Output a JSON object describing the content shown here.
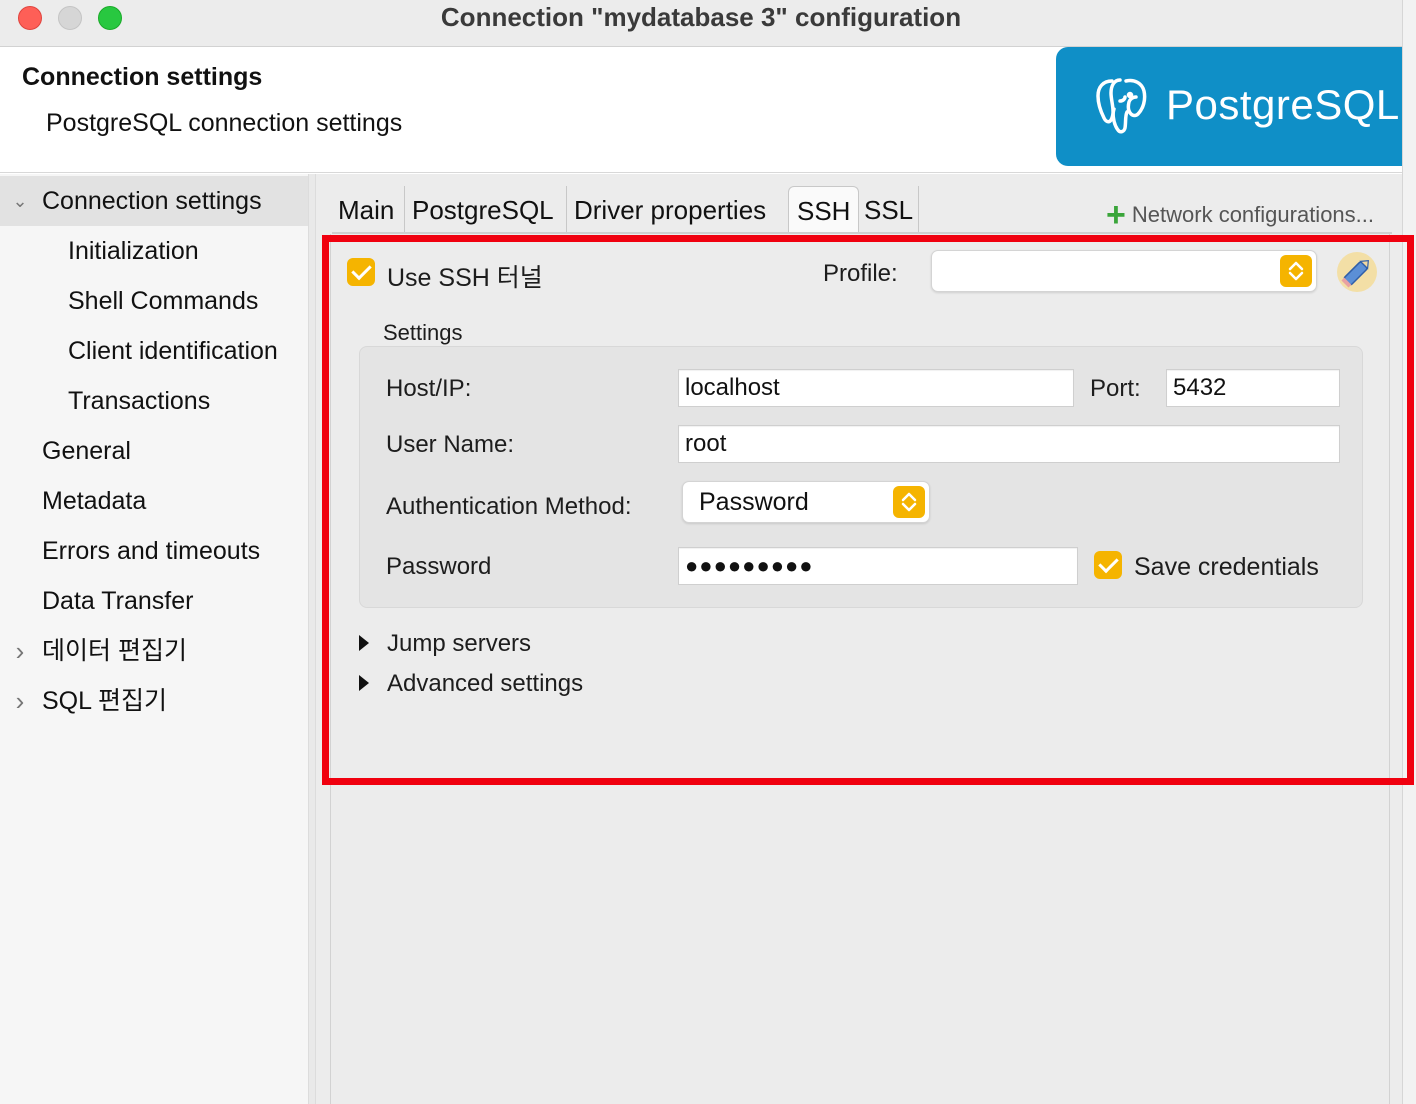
{
  "window": {
    "title": "Connection \"mydatabase 3\" configuration"
  },
  "header": {
    "title": "Connection settings",
    "subtitle": "PostgreSQL connection settings",
    "logo_text": "PostgreSQL"
  },
  "sidebar": {
    "items": [
      {
        "label": "Connection settings",
        "arrow": "⌄",
        "selected": true
      },
      {
        "label": "Initialization"
      },
      {
        "label": "Shell Commands"
      },
      {
        "label": "Client identification"
      },
      {
        "label": "Transactions"
      },
      {
        "label": "General"
      },
      {
        "label": "Metadata"
      },
      {
        "label": "Errors and timeouts"
      },
      {
        "label": "Data Transfer"
      },
      {
        "label": "데이터 편집기",
        "arrow": "›"
      },
      {
        "label": "SQL 편집기",
        "arrow": "›"
      }
    ]
  },
  "tabs": {
    "items": [
      "Main",
      "PostgreSQL",
      "Driver properties",
      "SSH",
      "SSL"
    ],
    "active": "SSH",
    "network_config": "Network configurations..."
  },
  "ssh": {
    "use_tunnel_label": "Use SSH 터널",
    "use_tunnel_checked": true,
    "profile_label": "Profile:",
    "profile_value": "",
    "settings_label": "Settings",
    "host_label": "Host/IP:",
    "host_value": "localhost",
    "port_label": "Port:",
    "port_value": "5432",
    "user_label": "User Name:",
    "user_value": "root",
    "auth_label": "Authentication Method:",
    "auth_value": "Password",
    "password_label": "Password",
    "password_value": "●●●●●●●●●",
    "save_credentials_label": "Save credentials",
    "save_credentials_checked": true,
    "jump_servers_label": "Jump servers",
    "advanced_label": "Advanced settings"
  },
  "colors": {
    "accent": "#f5b400",
    "highlight_box": "#f0000f",
    "logo_bg": "#0f8fc7"
  },
  "icons": {
    "edit": "pencil-icon",
    "add": "plus-icon",
    "stepper": "up-down-stepper-icon",
    "logo": "postgresql-elephant-icon"
  }
}
